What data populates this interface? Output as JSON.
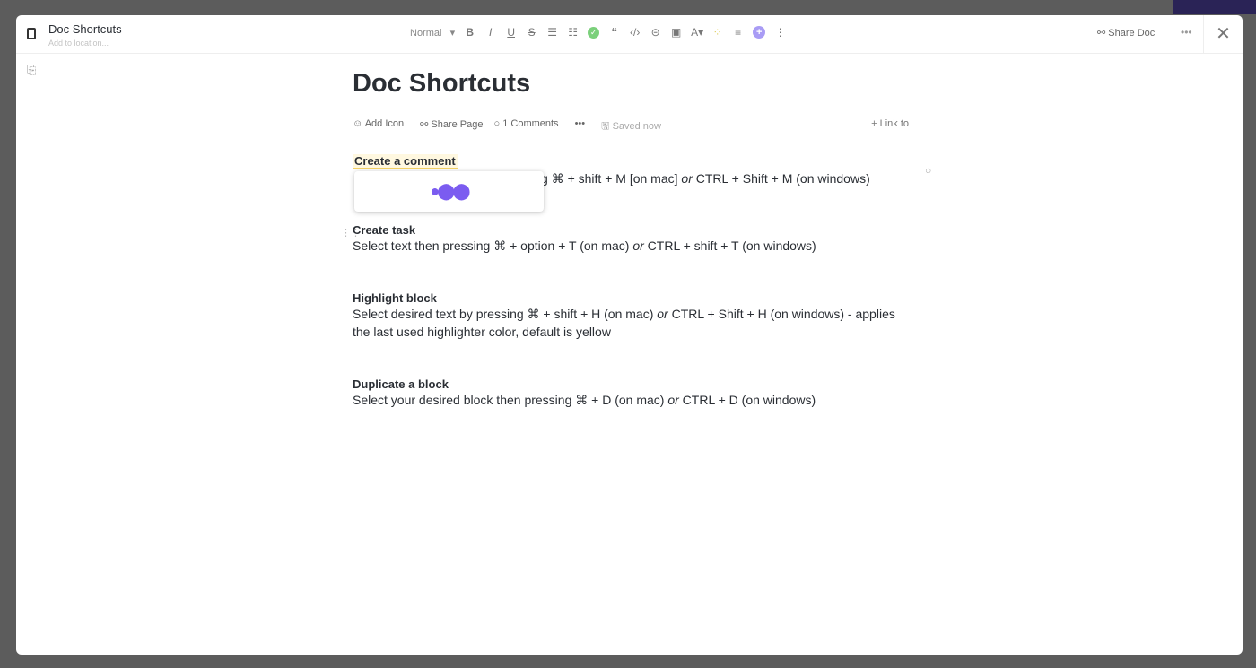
{
  "header": {
    "title": "Doc Shortcuts",
    "location_placeholder": "Add to location...",
    "text_style": "Normal",
    "share_doc": "Share Doc"
  },
  "toolbar_icons": [
    "bold-icon",
    "italic-icon",
    "underline-icon",
    "strikethrough-icon",
    "bullet-list-icon",
    "numbered-list-icon",
    "checklist-icon",
    "quote-icon",
    "code-icon",
    "link-icon",
    "embed-icon",
    "text-color-icon",
    "highlight-color-icon",
    "align-icon",
    "add-icon",
    "more-icon"
  ],
  "doc": {
    "title": "Doc Shortcuts",
    "meta": {
      "add_icon": "Add Icon",
      "share_page": "Share Page",
      "comments": "1 Comments",
      "saved": "Saved now",
      "link_to": "+ Link to"
    },
    "blocks": [
      {
        "title": "Create a comment",
        "body": "g ⌘ + shift + M [on mac] ",
        "or": "or",
        "body2": " CTRL + Shift + M (on windows)"
      },
      {
        "title": "Create task",
        "body": "Select text then pressing ⌘ + option + T (on mac) ",
        "or": "or",
        "body2": " CTRL + shift + T (on windows)"
      },
      {
        "title": "Highlight block",
        "body": "Select desired text by pressing ⌘ + shift + H (on mac) ",
        "or": "or",
        "body2": " CTRL + Shift + H (on windows) - applies the last used highlighter color, default is yellow"
      },
      {
        "title": "Duplicate a block",
        "body": "Select your desired block then pressing ⌘ + D (on mac) ",
        "or": "or",
        "body2": " CTRL + D (on windows)"
      }
    ]
  },
  "colors": {
    "accent": "#7b5cf0",
    "highlight": "#f6d365"
  }
}
